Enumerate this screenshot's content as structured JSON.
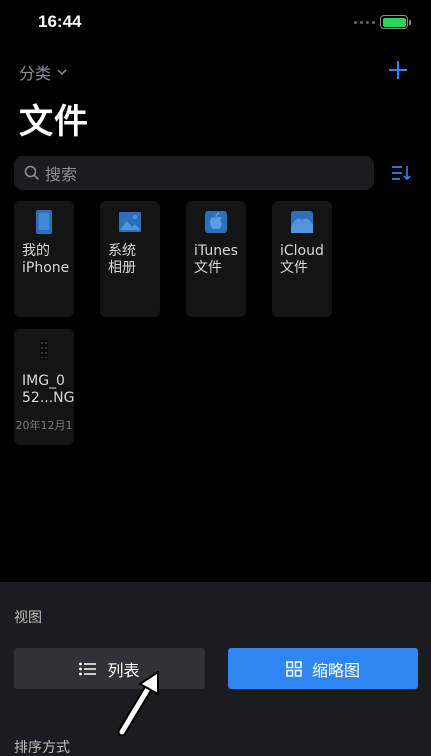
{
  "status_bar": {
    "time": "16:44",
    "battery_color": "#2fd158"
  },
  "nav": {
    "category_label": "分类",
    "add_icon": "plus-icon",
    "accent": "#2d86f1"
  },
  "page": {
    "title": "文件"
  },
  "search": {
    "placeholder": "搜索",
    "sort_icon": "sort-list-icon"
  },
  "files": [
    {
      "label": "我的\niPhone",
      "icon": "phone-icon"
    },
    {
      "label": "系统\n相册",
      "icon": "photo-icon"
    },
    {
      "label": "iTunes\n文件",
      "icon": "apple-icon"
    },
    {
      "label": "iCloud\n文件",
      "icon": "cloud-icon"
    },
    {
      "label": "IMG_0\n52...NG",
      "sub": "20年12月1",
      "icon": "file-icon"
    }
  ],
  "bottom_sheet": {
    "view_label": "视图",
    "list_button": "列表",
    "thumbnail_button": "缩略图",
    "sort_label": "排序方式"
  }
}
